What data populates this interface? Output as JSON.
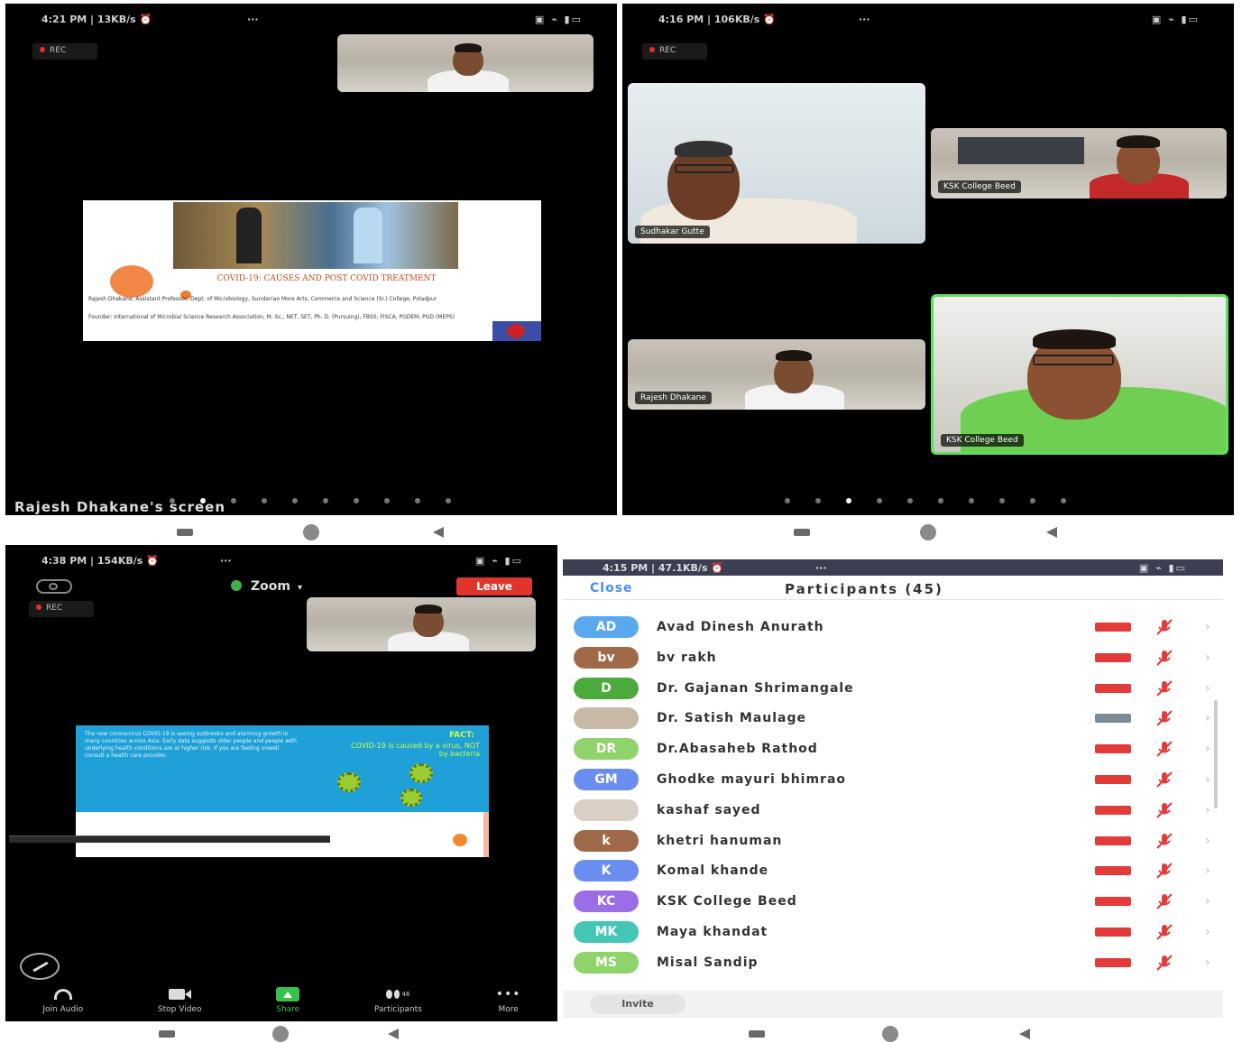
{
  "panel1": {
    "status_time": "4:21 PM | 13KB/s ⏰",
    "status_dots": "···",
    "status_icons": "▣ ⌁ ▮▭",
    "rec": "REC",
    "slide": {
      "title": "COVID-19: CAUSES AND POST COVID TREATMENT",
      "author": "Rajesh Dhakane, Assistant Professor, Dept. of Microbiology, Sundarrao More Arts, Commerce and Science (Sr.) College, Poladpur",
      "details": "Founder: International of Microbial Science Research Association, M. Sc., NET, SET, Ph. D. (Pursuing), FBSS, FISCA, PGDEM, PGD (MEPS)"
    },
    "caption": "Rajesh Dhakane's screen"
  },
  "panel2": {
    "status_time": "4:16 PM | 106KB/s ⏰",
    "status_dots": "···",
    "status_icons": "▣ ⌁ ▮▭",
    "rec": "REC",
    "tiles": [
      {
        "name": "Sudhakar Gutte"
      },
      {
        "name": "KSK College Beed"
      },
      {
        "name": "Rajesh Dhakane"
      },
      {
        "name": "KSK College Beed"
      }
    ]
  },
  "panel3": {
    "status_time": "4:38 PM | 154KB/s ⏰",
    "status_dots": "···",
    "status_icons": "▣ ⌁ ▮▭",
    "rec": "REC",
    "zoom_label": "Zoom",
    "leave_label": "Leave",
    "slide": {
      "left_text": "The new coronavirus COVID-19 is seeing outbreaks and alarming growth in many countries across Asia. Early data suggests older people and people with underlying health conditions are at higher risk. If you are feeling unwell consult a health care provider.",
      "fact_label": "FACT:",
      "fact_text": "COVID-19 is caused by a virus, NOT by bacteria"
    },
    "toolbar": [
      {
        "label": "Join Audio",
        "icon": "headphones-icon"
      },
      {
        "label": "Stop Video",
        "icon": "video-camera-icon"
      },
      {
        "label": "Share",
        "icon": "share-screen-icon"
      },
      {
        "label": "Participants",
        "icon": "participants-icon",
        "count": "46"
      },
      {
        "label": "More",
        "icon": "more-icon"
      }
    ]
  },
  "panel4": {
    "status_time": "4:15 PM | 47.1KB/s ⏰",
    "status_dots": "···",
    "status_icons": "▣ ⌁ ▮▭",
    "close_label": "Close",
    "title": "Participants (45)",
    "invite_label": "Invite",
    "participants": [
      {
        "initials": "AD",
        "name": "Avad Dinesh Anurath",
        "color": "#5aa9ef",
        "cam": "off"
      },
      {
        "initials": "bv",
        "name": "bv rakh",
        "color": "#a06a4a",
        "cam": "off"
      },
      {
        "initials": "D",
        "name": "Dr. Gajanan Shrimangale",
        "color": "#4caa3c",
        "cam": "off"
      },
      {
        "initials": "",
        "name": "Dr. Satish Maulage",
        "color": "#c8b8a6",
        "cam": "on"
      },
      {
        "initials": "DR",
        "name": "Dr.Abasaheb Rathod",
        "color": "#8fd46a",
        "cam": "off"
      },
      {
        "initials": "GM",
        "name": "Ghodke mayuri bhimrao",
        "color": "#6a8ef0",
        "cam": "off"
      },
      {
        "initials": "",
        "name": "kashaf sayed",
        "color": "#d9cfc4",
        "cam": "off"
      },
      {
        "initials": "k",
        "name": "khetri hanuman",
        "color": "#a06a4a",
        "cam": "off"
      },
      {
        "initials": "K",
        "name": "Komal  khande",
        "color": "#6a8ef0",
        "cam": "off"
      },
      {
        "initials": "KC",
        "name": "KSK College Beed",
        "color": "#9b6ee8",
        "cam": "off"
      },
      {
        "initials": "MK",
        "name": "Maya khandat",
        "color": "#45c6b4",
        "cam": "off"
      },
      {
        "initials": "MS",
        "name": "Misal Sandip",
        "color": "#8fd46a",
        "cam": "off"
      }
    ]
  }
}
